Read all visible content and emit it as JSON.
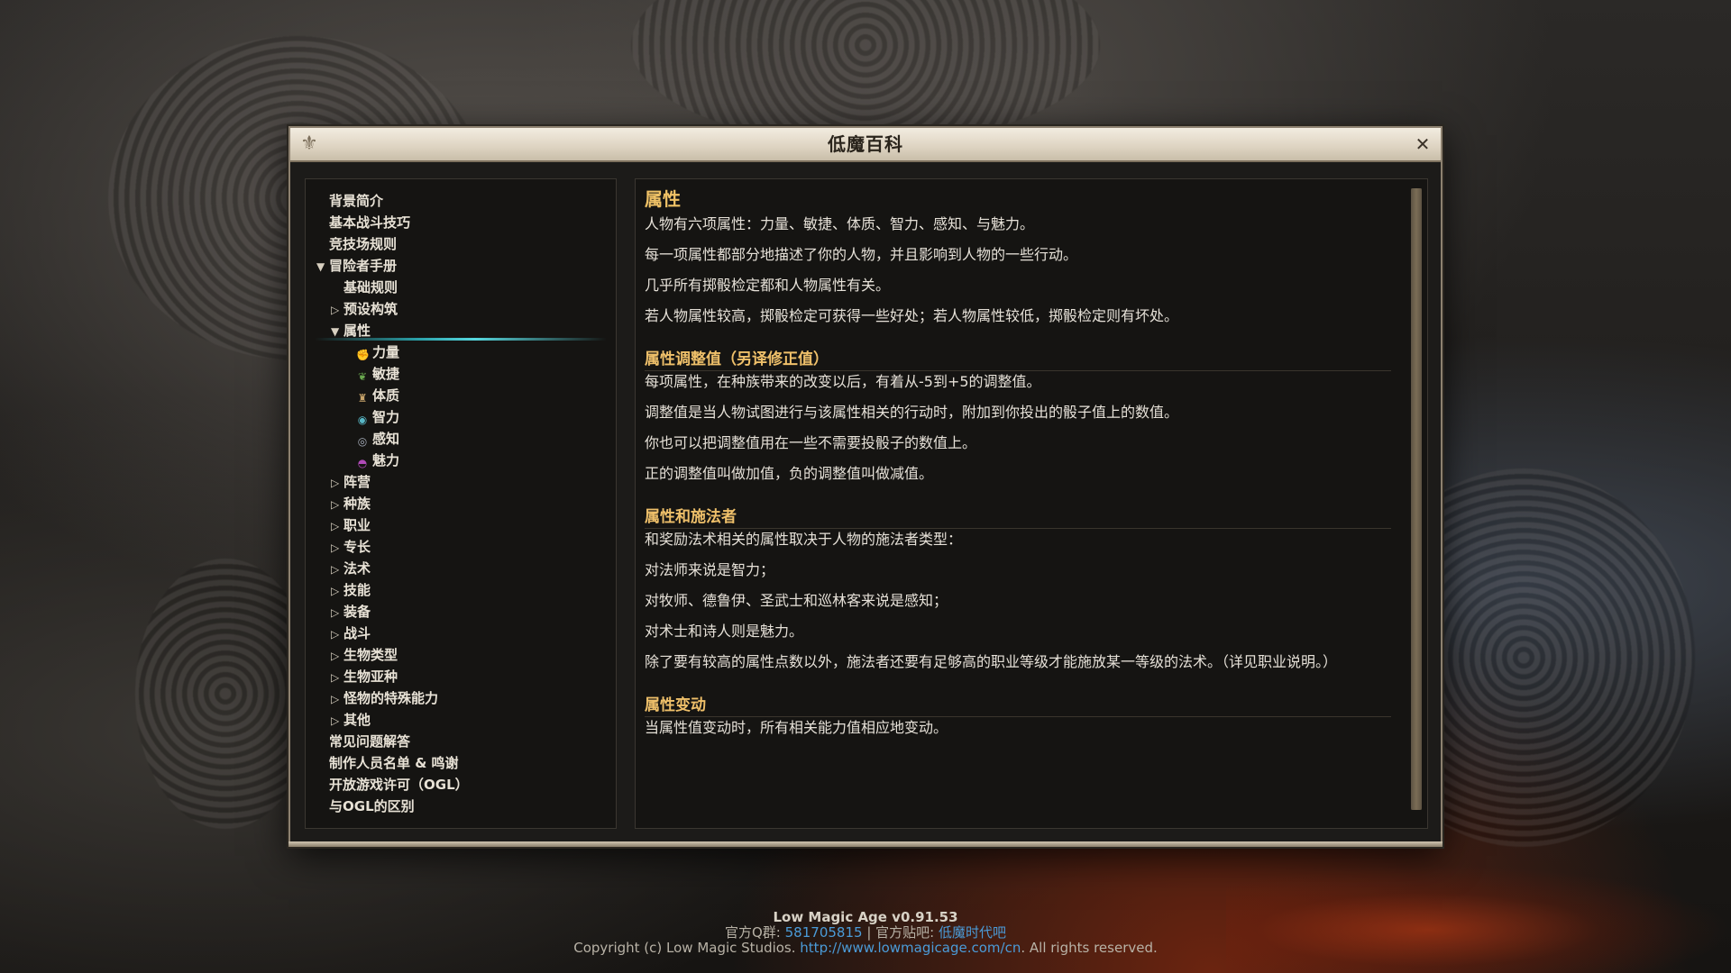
{
  "window": {
    "title": "低魔百科",
    "close_symbol": "✕"
  },
  "nav": {
    "items": [
      {
        "label": "背景简介",
        "level": 0,
        "expander": ""
      },
      {
        "label": "基本战斗技巧",
        "level": 0,
        "expander": ""
      },
      {
        "label": "竞技场规则",
        "level": 0,
        "expander": ""
      },
      {
        "label": "冒险者手册",
        "level": 0,
        "expander": "▼"
      },
      {
        "label": "基础规则",
        "level": 1,
        "expander": ""
      },
      {
        "label": "预设构筑",
        "level": 1,
        "expander": "▷"
      },
      {
        "label": "属性",
        "level": 1,
        "expander": "▼",
        "selected": true
      },
      {
        "label": "力量",
        "level": 2,
        "icon": "strength-icon",
        "icon_glyph": "✊",
        "icon_color": "#c96a3a"
      },
      {
        "label": "敏捷",
        "level": 2,
        "icon": "dexterity-icon",
        "icon_glyph": "❦",
        "icon_color": "#6aa84f"
      },
      {
        "label": "体质",
        "level": 2,
        "icon": "constitution-icon",
        "icon_glyph": "♜",
        "icon_color": "#c8a46a"
      },
      {
        "label": "智力",
        "level": 2,
        "icon": "intelligence-icon",
        "icon_glyph": "◉",
        "icon_color": "#58b7c6"
      },
      {
        "label": "感知",
        "level": 2,
        "icon": "wisdom-icon",
        "icon_glyph": "◎",
        "icon_color": "#a9b0bd"
      },
      {
        "label": "魅力",
        "level": 2,
        "icon": "charisma-icon",
        "icon_glyph": "◓",
        "icon_color": "#b04ab8"
      },
      {
        "label": "阵营",
        "level": 1,
        "expander": "▷"
      },
      {
        "label": "种族",
        "level": 1,
        "expander": "▷"
      },
      {
        "label": "职业",
        "level": 1,
        "expander": "▷"
      },
      {
        "label": "专长",
        "level": 1,
        "expander": "▷"
      },
      {
        "label": "法术",
        "level": 1,
        "expander": "▷"
      },
      {
        "label": "技能",
        "level": 1,
        "expander": "▷"
      },
      {
        "label": "装备",
        "level": 1,
        "expander": "▷"
      },
      {
        "label": "战斗",
        "level": 1,
        "expander": "▷"
      },
      {
        "label": "生物类型",
        "level": 1,
        "expander": "▷"
      },
      {
        "label": "生物亚种",
        "level": 1,
        "expander": "▷"
      },
      {
        "label": "怪物的特殊能力",
        "level": 1,
        "expander": "▷"
      },
      {
        "label": "其他",
        "level": 1,
        "expander": "▷"
      },
      {
        "label": "常见问题解答",
        "level": 0,
        "expander": ""
      },
      {
        "label": "制作人员名单 & 鸣谢",
        "level": 0,
        "expander": ""
      },
      {
        "label": "开放游戏许可（OGL）",
        "level": 0,
        "expander": ""
      },
      {
        "label": "与OGL的区别",
        "level": 0,
        "expander": ""
      }
    ]
  },
  "content": {
    "title": "属性",
    "intro": [
      "人物有六项属性：力量、敏捷、体质、智力、感知、与魅力。",
      "每一项属性都部分地描述了你的人物，并且影响到人物的一些行动。",
      "几乎所有掷骰检定都和人物属性有关。",
      "若人物属性较高，掷骰检定可获得一些好处；若人物属性较低，掷骰检定则有坏处。"
    ],
    "sections": [
      {
        "heading": "属性调整值（另译修正值）",
        "paragraphs": [
          "每项属性，在种族带来的改变以后，有着从-5到+5的调整值。",
          "调整值是当人物试图进行与该属性相关的行动时，附加到你投出的骰子值上的数值。",
          "你也可以把调整值用在一些不需要投骰子的数值上。",
          "正的调整值叫做加值，负的调整值叫做减值。"
        ]
      },
      {
        "heading": "属性和施法者",
        "paragraphs": [
          "和奖励法术相关的属性取决于人物的施法者类型：",
          "对法师来说是智力；",
          "对牧师、德鲁伊、圣武士和巡林客来说是感知；",
          "对术士和诗人则是魅力。",
          "除了要有较高的属性点数以外，施法者还要有足够高的职业等级才能施放某一等级的法术。（详见职业说明。）"
        ]
      },
      {
        "heading": "属性变动",
        "paragraphs": [
          "当属性值变动时，所有相关能力值相应地变动。"
        ]
      }
    ]
  },
  "footer": {
    "version": "Low Magic Age v0.91.53",
    "qq_label": "官方Q群: ",
    "qq_number": "581705815",
    "separator": " | 官方贴吧: ",
    "tieba": "低魔时代吧",
    "copyright_prefix": "Copyright (c) Low Magic Studios. ",
    "url": "http://www.lowmagicage.com/cn",
    "copyright_suffix": ". All rights reserved."
  }
}
